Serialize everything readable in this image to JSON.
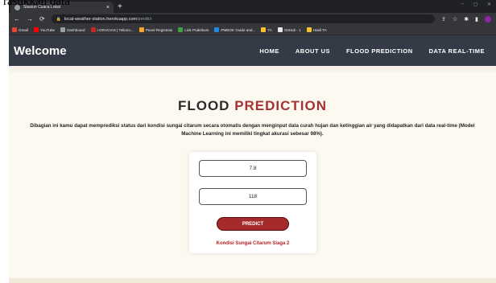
{
  "caption": "rasukkan data",
  "browser": {
    "tab": {
      "title": "Stasiun Cuaca Lokal",
      "close": "×"
    },
    "new_tab": "+",
    "window_controls": {
      "minimize": "–",
      "maximize": "◻",
      "close": "✕"
    },
    "nav": {
      "back": "←",
      "forward": "→",
      "reload": "⟳"
    },
    "url": {
      "host": "local-weather-station.herokuapp.com",
      "path": "/predict"
    },
    "bookmarks": [
      {
        "label": "Gmail",
        "color": "#ea4335"
      },
      {
        "label": "YouTube",
        "color": "#ff0000"
      },
      {
        "label": "Dashboard",
        "color": "#9aa0a6"
      },
      {
        "label": "i-GRACIAS | Telkom...",
        "color": "#c62828"
      },
      {
        "label": "Panel Registrasi",
        "color": "#f9a825"
      },
      {
        "label": "Link Praktikum",
        "color": "#43a047"
      },
      {
        "label": "PMBOK Guide and...",
        "color": "#1e88e5"
      },
      {
        "label": "TA",
        "color": "#fbc02d"
      },
      {
        "label": "GitHub - 1",
        "color": "#e8eaed"
      },
      {
        "label": "Hasil TA",
        "color": "#fbc02d"
      }
    ]
  },
  "site": {
    "brand": "Welcome",
    "nav": [
      "HOME",
      "ABOUT US",
      "FLOOD PREDICTION",
      "DATA REAL-TIME"
    ]
  },
  "main": {
    "heading_dark": "FLOOD",
    "heading_red": "PREDICTION",
    "description": "Dibagian ini kamu dapat memprediksi status dari kondisi sungai citarum secara otomatis dengan menginput data curah hujan dan ketinggian air yang didapatkan dari data real-time (Model Machine Learning ini memiliki tingkat akurasi sebesar 98%).",
    "rainfall_value": "7.8",
    "water_level_value": "118",
    "predict_label": "PREDICT",
    "result": "Kondisi Sungai Citarum Siaga 2"
  },
  "colors": {
    "navbar": "#343a46",
    "accent_red": "#a52a2a",
    "page_bg": "#fcf9f1"
  }
}
